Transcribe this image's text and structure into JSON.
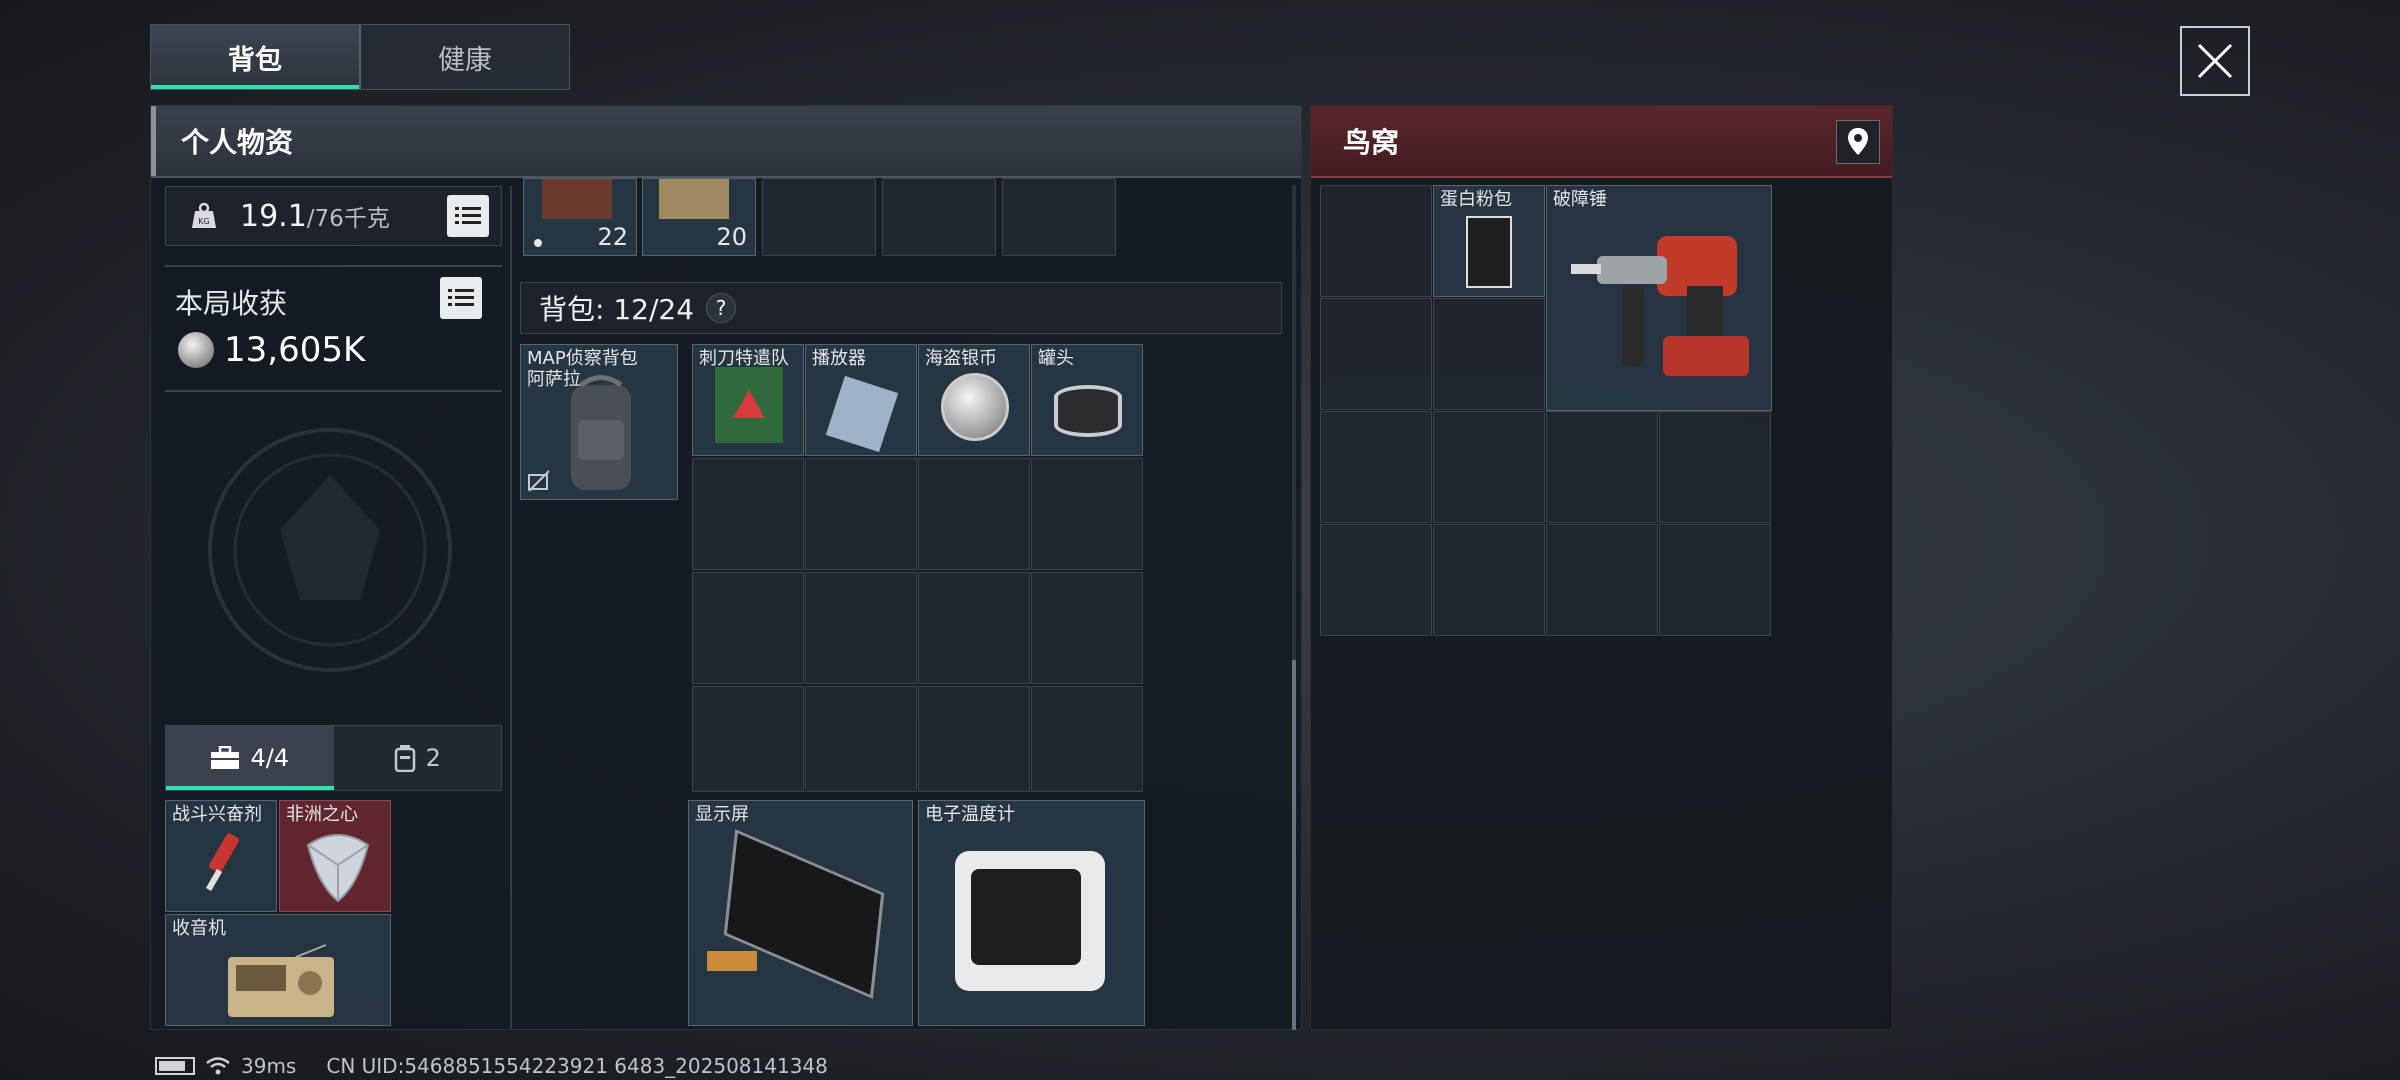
{
  "tabs": [
    {
      "label": "背包"
    },
    {
      "label": "健康"
    }
  ],
  "personal": {
    "title": "个人物资",
    "weight_current": "19.1",
    "weight_max": "/76千克",
    "weight_icon_text": "KG",
    "earnings_label": "本局收获",
    "earnings_value": "13,605K"
  },
  "top_row": [
    {
      "count": "22"
    },
    {
      "count": "20"
    }
  ],
  "bag": {
    "label": "背包: 12/24",
    "help": "?"
  },
  "backpack_item": {
    "label": "MAP侦察背包\n阿萨拉"
  },
  "bag_items": [
    {
      "label": "刺刀特遣队"
    },
    {
      "label": "播放器"
    },
    {
      "label": "海盗银币"
    },
    {
      "label": "罐头"
    }
  ],
  "large_items": [
    {
      "label": "显示屏"
    },
    {
      "label": "电子温度计"
    }
  ],
  "pouch": {
    "tab_secure": "4/4",
    "tab_other": "2",
    "items": [
      {
        "label": "战斗兴奋剂"
      },
      {
        "label": "非洲之心"
      },
      {
        "label": "收音机"
      }
    ]
  },
  "nest": {
    "title": "鸟窝",
    "items": [
      {
        "label": "蛋白粉包"
      },
      {
        "label": "破障锤"
      }
    ]
  },
  "status_bar": {
    "ping": "39ms",
    "uid": "CN UID:5468851554223921 6483_202508141348"
  },
  "colors": {
    "accent": "#2ee0b4",
    "nest_header": "#5a262b",
    "rare_item": "#6e2830"
  }
}
